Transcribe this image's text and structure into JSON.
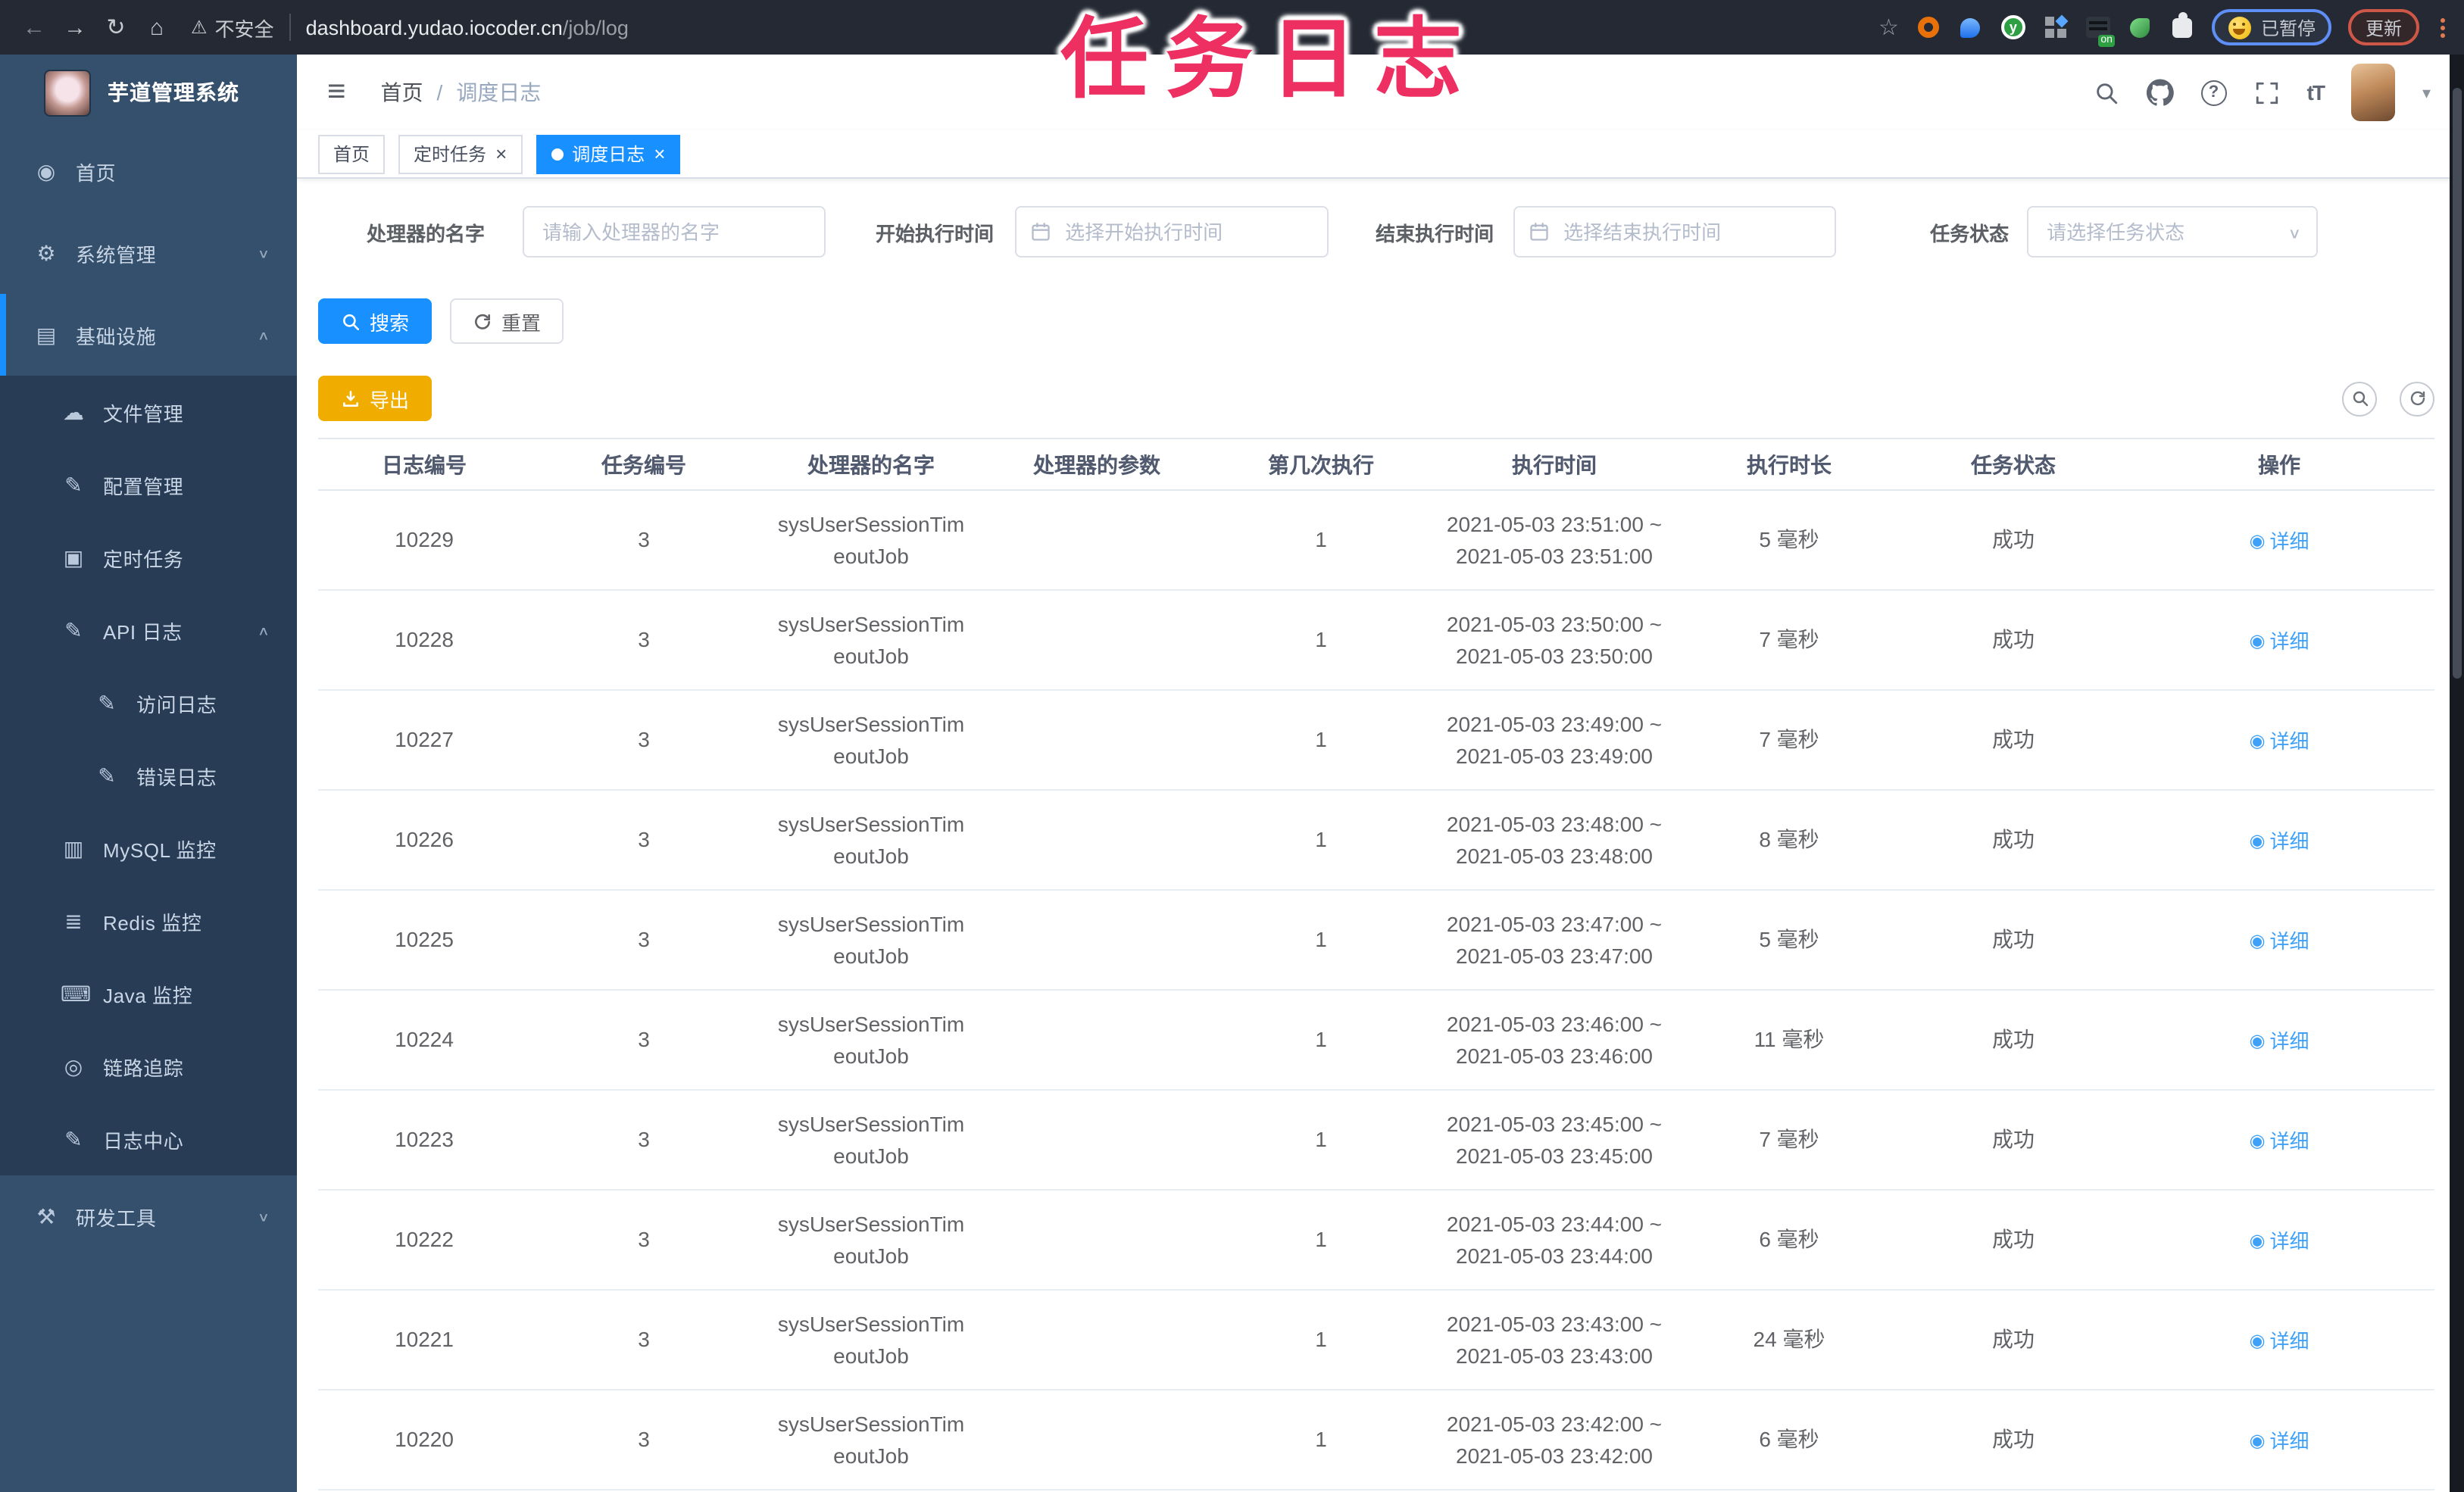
{
  "browser": {
    "security_text": "不安全",
    "url_domain": "dashboard.yudao.iocoder.cn",
    "url_path": "/job/log",
    "extension_on_badge": "on",
    "paused_badge": "已暂停",
    "update_button": "更新"
  },
  "overlay_title": "任务日志",
  "sidebar": {
    "app_title": "芋道管理系统",
    "menu": [
      {
        "id": "home",
        "label": "首页",
        "icon": "dashboard-icon",
        "level": 0
      },
      {
        "id": "system-management",
        "label": "系统管理",
        "icon": "gear-icon",
        "level": 0,
        "chevron": "down"
      },
      {
        "id": "infrastructure",
        "label": "基础设施",
        "icon": "monitor-icon",
        "level": 0,
        "chevron": "up",
        "active": true
      },
      {
        "id": "file-management",
        "label": "文件管理",
        "icon": "cloud-upload-icon",
        "level": 1
      },
      {
        "id": "config-management",
        "label": "配置管理",
        "icon": "edit-icon",
        "level": 1
      },
      {
        "id": "scheduled-task",
        "label": "定时任务",
        "icon": "schedule-icon",
        "level": 1
      },
      {
        "id": "api-log",
        "label": "API 日志",
        "icon": "log-icon",
        "level": 1,
        "chevron": "up"
      },
      {
        "id": "access-log",
        "label": "访问日志",
        "icon": "log-icon",
        "level": 2
      },
      {
        "id": "error-log",
        "label": "错误日志",
        "icon": "log-icon",
        "level": 2
      },
      {
        "id": "mysql-monitor",
        "label": "MySQL 监控",
        "icon": "database-icon",
        "level": 1
      },
      {
        "id": "redis-monitor",
        "label": "Redis 监控",
        "icon": "layers-icon",
        "level": 1
      },
      {
        "id": "java-monitor",
        "label": "Java 监控",
        "icon": "java-icon",
        "level": 1
      },
      {
        "id": "link-tracing",
        "label": "链路追踪",
        "icon": "eye-icon",
        "level": 1
      },
      {
        "id": "log-center",
        "label": "日志中心",
        "icon": "log-icon",
        "level": 1
      },
      {
        "id": "dev-tools",
        "label": "研发工具",
        "icon": "toolbox-icon",
        "level": 0,
        "chevron": "down"
      }
    ]
  },
  "topbar": {
    "breadcrumb_home": "首页",
    "breadcrumb_separator": "/",
    "breadcrumb_current": "调度日志"
  },
  "tags": [
    {
      "label": "首页",
      "active": false,
      "closable": false
    },
    {
      "label": "定时任务",
      "active": false,
      "closable": true
    },
    {
      "label": "调度日志",
      "active": true,
      "closable": true
    }
  ],
  "filters": {
    "handler_label": "处理器的名字",
    "handler_placeholder": "请输入处理器的名字",
    "begin_label": "开始执行时间",
    "begin_placeholder": "选择开始执行时间",
    "end_label": "结束执行时间",
    "end_placeholder": "选择结束执行时间",
    "status_label": "任务状态",
    "status_placeholder": "请选择任务状态",
    "search_button": "搜索",
    "reset_button": "重置"
  },
  "toolbar": {
    "export_button": "导出"
  },
  "table": {
    "columns": [
      "日志编号",
      "任务编号",
      "处理器的名字",
      "处理器的参数",
      "第几次执行",
      "执行时间",
      "执行时长",
      "任务状态",
      "操作"
    ],
    "rows": [
      {
        "log_id": "10229",
        "job_id": "3",
        "handler": "sysUserSessionTimeoutJob",
        "param": "",
        "execute_index": "1",
        "time_start": "2021-05-03 23:51:00 ~",
        "time_end": "2021-05-03 23:51:00",
        "duration": "5 毫秒",
        "status": "成功",
        "action": "详细"
      },
      {
        "log_id": "10228",
        "job_id": "3",
        "handler": "sysUserSessionTimeoutJob",
        "param": "",
        "execute_index": "1",
        "time_start": "2021-05-03 23:50:00 ~",
        "time_end": "2021-05-03 23:50:00",
        "duration": "7 毫秒",
        "status": "成功",
        "action": "详细"
      },
      {
        "log_id": "10227",
        "job_id": "3",
        "handler": "sysUserSessionTimeoutJob",
        "param": "",
        "execute_index": "1",
        "time_start": "2021-05-03 23:49:00 ~",
        "time_end": "2021-05-03 23:49:00",
        "duration": "7 毫秒",
        "status": "成功",
        "action": "详细"
      },
      {
        "log_id": "10226",
        "job_id": "3",
        "handler": "sysUserSessionTimeoutJob",
        "param": "",
        "execute_index": "1",
        "time_start": "2021-05-03 23:48:00 ~",
        "time_end": "2021-05-03 23:48:00",
        "duration": "8 毫秒",
        "status": "成功",
        "action": "详细"
      },
      {
        "log_id": "10225",
        "job_id": "3",
        "handler": "sysUserSessionTimeoutJob",
        "param": "",
        "execute_index": "1",
        "time_start": "2021-05-03 23:47:00 ~",
        "time_end": "2021-05-03 23:47:00",
        "duration": "5 毫秒",
        "status": "成功",
        "action": "详细"
      },
      {
        "log_id": "10224",
        "job_id": "3",
        "handler": "sysUserSessionTimeoutJob",
        "param": "",
        "execute_index": "1",
        "time_start": "2021-05-03 23:46:00 ~",
        "time_end": "2021-05-03 23:46:00",
        "duration": "11 毫秒",
        "status": "成功",
        "action": "详细"
      },
      {
        "log_id": "10223",
        "job_id": "3",
        "handler": "sysUserSessionTimeoutJob",
        "param": "",
        "execute_index": "1",
        "time_start": "2021-05-03 23:45:00 ~",
        "time_end": "2021-05-03 23:45:00",
        "duration": "7 毫秒",
        "status": "成功",
        "action": "详细"
      },
      {
        "log_id": "10222",
        "job_id": "3",
        "handler": "sysUserSessionTimeoutJob",
        "param": "",
        "execute_index": "1",
        "time_start": "2021-05-03 23:44:00 ~",
        "time_end": "2021-05-03 23:44:00",
        "duration": "6 毫秒",
        "status": "成功",
        "action": "详细"
      },
      {
        "log_id": "10221",
        "job_id": "3",
        "handler": "sysUserSessionTimeoutJob",
        "param": "",
        "execute_index": "1",
        "time_start": "2021-05-03 23:43:00 ~",
        "time_end": "2021-05-03 23:43:00",
        "duration": "24 毫秒",
        "status": "成功",
        "action": "详细"
      },
      {
        "log_id": "10220",
        "job_id": "3",
        "handler": "sysUserSessionTimeoutJob",
        "param": "",
        "execute_index": "1",
        "time_start": "2021-05-03 23:42:00 ~",
        "time_end": "2021-05-03 23:42:00",
        "duration": "6 毫秒",
        "status": "成功",
        "action": "详细"
      }
    ]
  }
}
